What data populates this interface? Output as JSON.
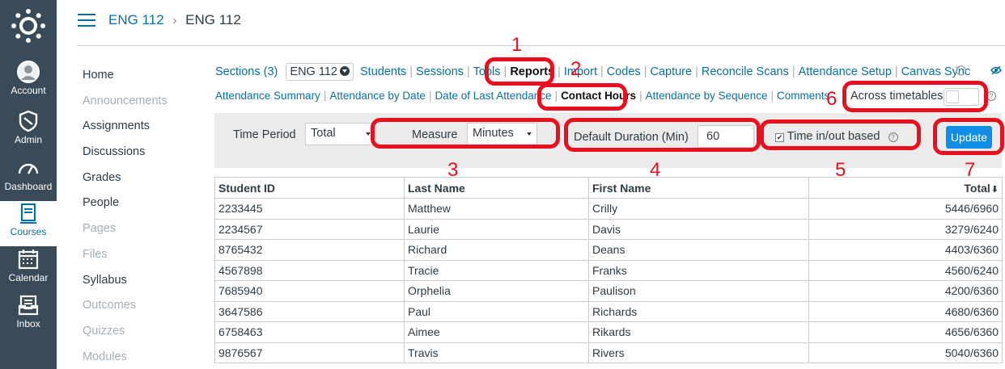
{
  "global_nav": {
    "items": [
      {
        "label": "Account",
        "icon": "account-icon"
      },
      {
        "label": "Admin",
        "icon": "admin-icon"
      },
      {
        "label": "Dashboard",
        "icon": "dashboard-icon"
      },
      {
        "label": "Courses",
        "icon": "courses-icon",
        "active": true
      },
      {
        "label": "Calendar",
        "icon": "calendar-icon"
      },
      {
        "label": "Inbox",
        "icon": "inbox-icon"
      }
    ],
    "colors": {
      "background": "#394b58",
      "active_text": "#0770a3"
    }
  },
  "header": {
    "breadcrumb_link": "ENG 112",
    "breadcrumb_separator": "›",
    "breadcrumb_current": "ENG 112"
  },
  "course_nav": [
    {
      "label": "Home",
      "enabled": true
    },
    {
      "label": "Announcements",
      "enabled": false
    },
    {
      "label": "Assignments",
      "enabled": true
    },
    {
      "label": "Discussions",
      "enabled": true
    },
    {
      "label": "Grades",
      "enabled": true
    },
    {
      "label": "People",
      "enabled": true
    },
    {
      "label": "Pages",
      "enabled": false
    },
    {
      "label": "Files",
      "enabled": false
    },
    {
      "label": "Syllabus",
      "enabled": true
    },
    {
      "label": "Outcomes",
      "enabled": false
    },
    {
      "label": "Quizzes",
      "enabled": false
    },
    {
      "label": "Modules",
      "enabled": false
    }
  ],
  "tool_tabs": {
    "sections_label": "Sections (3)",
    "section_selected": "ENG 112",
    "students": "Students",
    "sessions": "Sessions",
    "tools": "Tools",
    "reports": "Reports",
    "import": "Import",
    "codes": "Codes",
    "capture": "Capture",
    "reconcile_scans": "Reconcile Scans",
    "attendance_setup": "Attendance Setup",
    "canvas_sync": "Canvas Sync"
  },
  "report_tabs": {
    "attendance_summary": "Attendance Summary",
    "attendance_by_date": "Attendance by Date",
    "date_of_last_attendance": "Date of Last Attendance",
    "contact_hours": "Contact Hours",
    "attendance_by_sequence": "Attendance by Sequence",
    "comments": "Comments"
  },
  "across_timetables": {
    "label": "Across timetables",
    "checked": false
  },
  "filters": {
    "time_period_label": "Time Period",
    "time_period_value": "Total",
    "measure_label": "Measure",
    "measure_value": "Minutes",
    "default_duration_label": "Default Duration (Min)",
    "default_duration_value": "60",
    "time_in_out_label": "Time in/out based",
    "time_in_out_checked": true,
    "update_button": "Update"
  },
  "table": {
    "headers": [
      "Student ID",
      "Last Name",
      "First Name",
      "Total"
    ],
    "rows": [
      [
        "2233445",
        "Matthew",
        "Crilly",
        "5446/6960"
      ],
      [
        "2234567",
        "Laurie",
        "Davis",
        "3279/6240"
      ],
      [
        "8765432",
        "Richard",
        "Deans",
        "4403/6360"
      ],
      [
        "4567898",
        "Tracie",
        "Franks",
        "4560/6240"
      ],
      [
        "7685940",
        "Orphelia",
        "Paulison",
        "4200/6360"
      ],
      [
        "3647586",
        "Paul",
        "Richards",
        "4680/6360"
      ],
      [
        "6758463",
        "Aimee",
        "Rikards",
        "4656/6360"
      ],
      [
        "9876567",
        "Travis",
        "Rivers",
        "5040/6360"
      ]
    ]
  },
  "annotations": [
    "1",
    "2",
    "3",
    "4",
    "5",
    "6",
    "7"
  ],
  "annotation_color": "#e8101e",
  "accent_color": "#0770a3",
  "button_color": "#0f8ee3"
}
